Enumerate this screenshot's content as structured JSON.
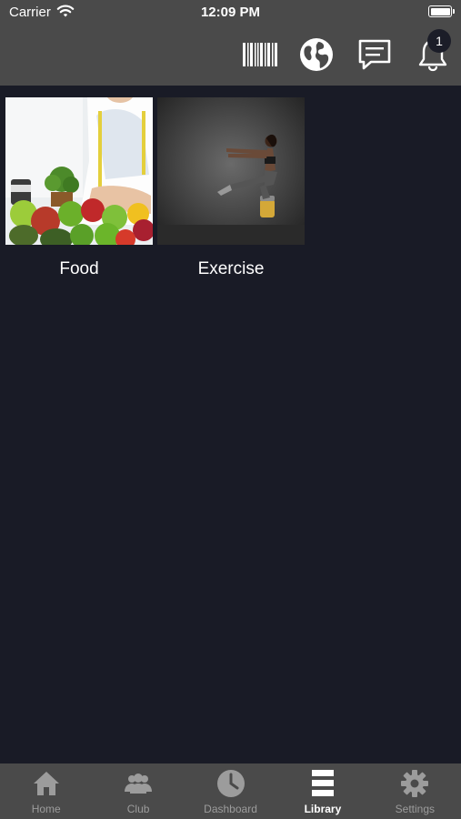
{
  "status_bar": {
    "carrier": "Carrier",
    "time": "12:09 PM"
  },
  "nav": {
    "icons": [
      "barcode-icon",
      "globe-icon",
      "chat-icon",
      "bell-icon"
    ],
    "notification_count": "1"
  },
  "library": {
    "items": [
      {
        "label": "Food",
        "image": "nutrition-photo"
      },
      {
        "label": "Exercise",
        "image": "fitness-photo"
      }
    ]
  },
  "tabs": [
    {
      "label": "Home",
      "icon": "home-icon"
    },
    {
      "label": "Club",
      "icon": "group-icon"
    },
    {
      "label": "Dashboard",
      "icon": "clock-icon"
    },
    {
      "label": "Library",
      "icon": "library-icon",
      "active": true
    },
    {
      "label": "Settings",
      "icon": "gear-icon"
    }
  ],
  "colors": {
    "background": "#191b26",
    "bar": "#4a4a4a",
    "inactive_tab": "#9c9c9c",
    "badge": "#1b1d28"
  }
}
